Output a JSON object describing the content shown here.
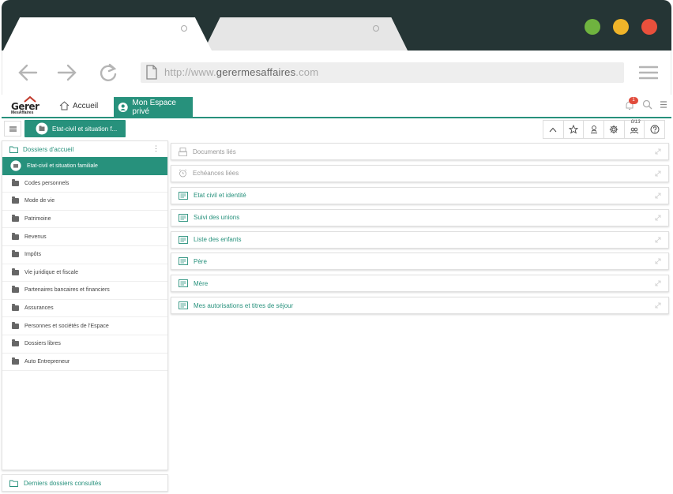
{
  "browser": {
    "url_prefix": "http://www.",
    "url_domain": "gerermesaffaires",
    "url_suffix": ".com",
    "window_controls": [
      "green",
      "yellow",
      "red"
    ],
    "colors": {
      "chrome": "#253535",
      "green": "#6fb33f",
      "yellow": "#f0b429",
      "red": "#e9503c"
    }
  },
  "header": {
    "logo_main": "Gerer",
    "logo_sub": "MesAffaires",
    "nav_home": "Accueil",
    "nav_space": "Mon Espace privé",
    "notification_count": "1"
  },
  "toolbar": {
    "current_folder": "Etat-civil et situation f...",
    "counter": "0/13",
    "tools": [
      "chevron-up-icon",
      "star-icon",
      "user-stamp-icon",
      "settings-icon",
      "users-icon",
      "help-icon"
    ]
  },
  "sidebar": {
    "title": "Dossiers d'accueil",
    "items": [
      {
        "label": "Etat-civil et situation familiale",
        "active": true
      },
      {
        "label": "Codes personnels"
      },
      {
        "label": "Mode de vie"
      },
      {
        "label": "Patrimoine"
      },
      {
        "label": "Revenus"
      },
      {
        "label": "Impôts"
      },
      {
        "label": "Vie juridique et fiscale"
      },
      {
        "label": "Partenaires bancaires et financiers"
      },
      {
        "label": "Assurances"
      },
      {
        "label": "Personnes et sociétés de l'Espace"
      },
      {
        "label": "Dossiers libres"
      },
      {
        "label": "Auto Entrepreneur"
      }
    ],
    "footer": "Derniers dossiers consultés"
  },
  "main": {
    "panels": [
      {
        "label": "Documents liés",
        "icon": "documents-icon",
        "dim": true
      },
      {
        "label": "Echéances liées",
        "icon": "alarm-icon",
        "dim": true
      },
      {
        "label": "Etat civil et identité",
        "icon": "form-icon"
      },
      {
        "label": "Suivi des unions",
        "icon": "form-icon"
      },
      {
        "label": "Liste des enfants",
        "icon": "form-icon"
      },
      {
        "label": "Père",
        "icon": "form-icon"
      },
      {
        "label": "Mère",
        "icon": "form-icon"
      },
      {
        "label": "Mes autorisations et titres de séjour",
        "icon": "form-icon"
      }
    ]
  },
  "accent_color": "#27917c"
}
